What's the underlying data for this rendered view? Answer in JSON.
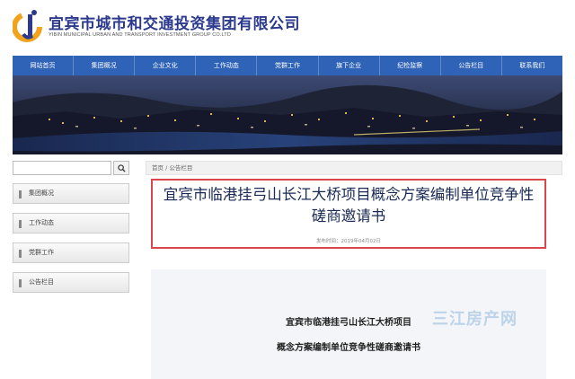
{
  "header": {
    "company_cn": "宜宾市城市和交通投资集团有限公司",
    "company_en": "YIBIN MUNICIPAL URBAN AND TRANSPORT INVESTMENT GROUP CO.LTD"
  },
  "nav": {
    "items": [
      "网站首页",
      "集团概况",
      "企业文化",
      "工作动态",
      "党群工作",
      "旗下企业",
      "纪检监察",
      "公告栏目",
      "联系我们"
    ]
  },
  "sidebar": {
    "search_placeholder": "",
    "items": [
      "集团概况",
      "工作动态",
      "党群工作",
      "公告栏目"
    ]
  },
  "breadcrumb": "首页 / 公告栏目",
  "article": {
    "title": "宜宾市临港挂弓山长江大桥项目概念方案编制单位竞争性磋商邀请书",
    "date": "发布时间：2019年04月02日",
    "doc_line1": "宜宾市临港挂弓山长江大桥项目",
    "doc_line2": "概念方案编制单位竞争性磋商邀请书"
  },
  "watermark": "三江房产网",
  "colors": {
    "brand_blue": "#2c3a8e",
    "nav_blue": "#2f63b7",
    "highlight_red": "#d9464b"
  }
}
